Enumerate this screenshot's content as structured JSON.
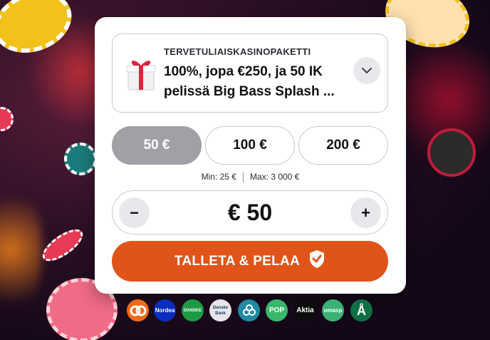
{
  "promo": {
    "eyebrow": "TERVETULIAISKASINOPAKETTI",
    "title": "100%, jopa €250, ja 50 IK pelissä Big Bass Splash ...",
    "gift_icon": "gift-icon",
    "expand_icon": "chevron-down-icon"
  },
  "amounts": {
    "options": [
      {
        "label": "50 €",
        "selected": true
      },
      {
        "label": "100 €",
        "selected": false
      },
      {
        "label": "200 €",
        "selected": false
      }
    ]
  },
  "limits": {
    "min": "Min: 25 €",
    "max": "Max: 3 000 €"
  },
  "stepper": {
    "decrement": "−",
    "increment": "+",
    "value": "€ 50"
  },
  "cta": {
    "label": "TALLETA & PELAA",
    "icon": "shield-check-icon"
  },
  "banks": [
    {
      "name": "op-icon",
      "label": "",
      "color": "#f06a17"
    },
    {
      "name": "nordea-icon",
      "label": "Nordea",
      "color": "#0b2dbf"
    },
    {
      "name": "danske-icon",
      "label": "DANSKE",
      "color": "#1e9a45"
    },
    {
      "name": "danske-bank-icon",
      "label": "Danske Bank",
      "color": "#e6e6ea"
    },
    {
      "name": "saastopankki-icon",
      "label": "",
      "color": "#1f8aa0"
    },
    {
      "name": "pop-icon",
      "label": "POP",
      "color": "#39b86c"
    },
    {
      "name": "aktia-icon",
      "label": "Aktia",
      "color": "#0d0d0d"
    },
    {
      "name": "omasp-icon",
      "label": "omasp",
      "color": "#3bb273"
    },
    {
      "name": "alandsbanken-icon",
      "label": "Å",
      "color": "#0e6f45"
    }
  ],
  "colors": {
    "accent": "#e0541a",
    "selected_amount": "#a0a0a6"
  }
}
